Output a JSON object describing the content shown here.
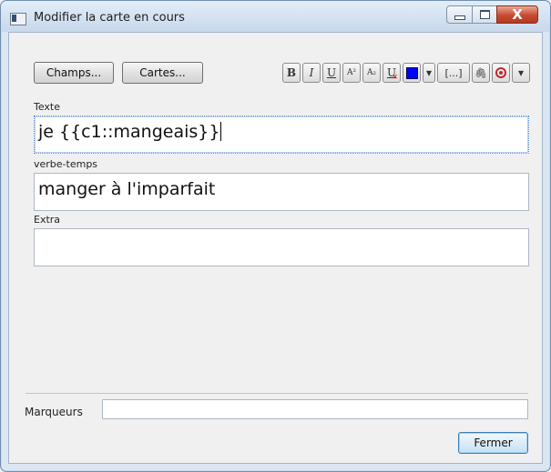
{
  "window": {
    "title": "Modifier la carte en cours",
    "close_glyph": "X"
  },
  "top_buttons": {
    "fields_label": "Champs...",
    "cards_label": "Cartes..."
  },
  "format_toolbar": [
    {
      "name": "bold-button",
      "label": "B"
    },
    {
      "name": "italic-button",
      "label": "I"
    },
    {
      "name": "underline-button",
      "label": "U"
    },
    {
      "name": "superscript-button",
      "label": "A²"
    },
    {
      "name": "subscript-button",
      "label": "A₂"
    },
    {
      "name": "clear-format-button",
      "label": "U"
    },
    {
      "name": "text-color-button",
      "label": ""
    },
    {
      "name": "color-dropdown-button",
      "label": "▾"
    },
    {
      "name": "cloze-button",
      "label": "[...]"
    },
    {
      "name": "attach-media-button",
      "label": "🖇"
    },
    {
      "name": "record-audio-button",
      "label": ""
    },
    {
      "name": "more-options-button",
      "label": "▾"
    }
  ],
  "fields": [
    {
      "label": "Texte",
      "value": "je {{c1::mangeais}}"
    },
    {
      "label": "verbe-temps",
      "value": "manger à l'imparfait"
    },
    {
      "label": "Extra",
      "value": ""
    }
  ],
  "tags": {
    "label": "Marqueurs",
    "value": ""
  },
  "footer": {
    "close_label": "Fermer"
  },
  "colors": {
    "text_color": "#0000ff",
    "record": "#c0272d",
    "title_close": "#c84a2f"
  }
}
